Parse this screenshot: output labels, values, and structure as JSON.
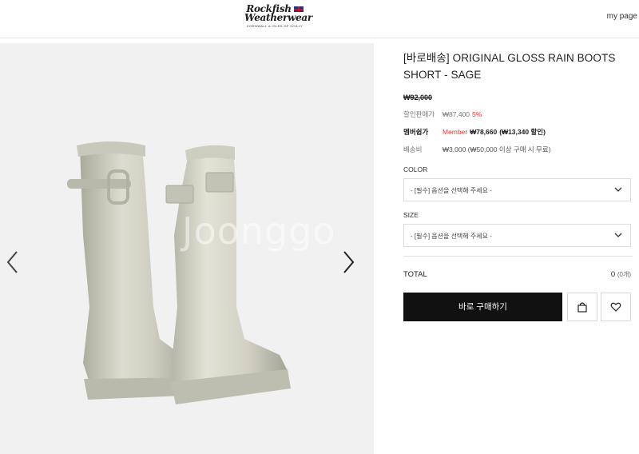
{
  "header": {
    "logo_line1": "Rockfish",
    "logo_line2": "Weatherwear",
    "logo_tagline": "CORNWALL & ISLES OF SCILLY",
    "mypage": "my page"
  },
  "gallery": {
    "watermark": "Joonggo"
  },
  "product": {
    "title": "[바로배송] ORIGINAL GLOSS RAIN BOOTS SHORT - SAGE",
    "original_price": "₩92,000",
    "discount_label": "할인판매가",
    "discount_price": "₩87,400",
    "discount_pct": "5%",
    "member_label": "멤버쉽가",
    "member_word": "Member",
    "member_price": "₩78,660",
    "member_saving": "(₩13,340 할인)",
    "shipping_label": "배송비",
    "shipping_value": "₩3,000 (₩50,000 이상 구매 시 무료)"
  },
  "options": {
    "color_label": "COLOR",
    "color_placeholder": "- [필수] 옵션을 선택해 주세요 -",
    "size_label": "SIZE",
    "size_placeholder": "- [필수] 옵션을 선택해 주세요 -"
  },
  "total": {
    "label": "TOTAL",
    "value": "0",
    "count": "(0개)"
  },
  "actions": {
    "buy_now": "바로 구매하기"
  },
  "icons": {
    "arrow_left": "chevron-left-icon",
    "arrow_right": "chevron-right-icon",
    "select_chevron": "chevron-down-icon",
    "cart": "shopping-bag-icon",
    "wishlist": "heart-icon"
  }
}
